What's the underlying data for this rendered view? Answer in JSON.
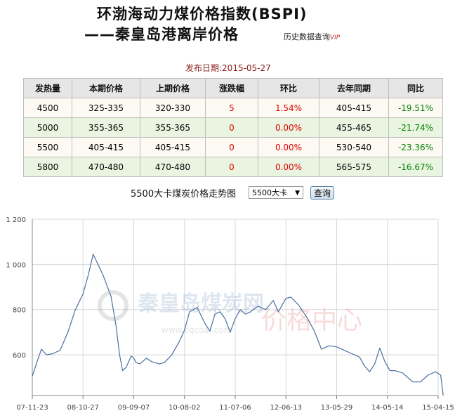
{
  "header": {
    "title": "环渤海动力煤价格指数(BSPI)",
    "subtitle": "——秦皇岛港离岸价格",
    "history_link": "历史数据查询",
    "vip": "VIP",
    "pub_date": "发布日期:2015-05-27"
  },
  "table": {
    "headers": [
      "发热量",
      "本期价格",
      "上期价格",
      "涨跌幅",
      "环比",
      "去年同期",
      "同比"
    ],
    "rows": [
      [
        "4500",
        "325-335",
        "320-330",
        "5",
        "1.54%",
        "405-415",
        "-19.51%"
      ],
      [
        "5000",
        "355-365",
        "355-365",
        "0",
        "0.00%",
        "455-465",
        "-21.74%"
      ],
      [
        "5500",
        "405-415",
        "405-415",
        "0",
        "0.00%",
        "530-540",
        "-23.36%"
      ],
      [
        "5800",
        "470-480",
        "470-480",
        "0",
        "0.00%",
        "565-575",
        "-16.67%"
      ]
    ]
  },
  "controls": {
    "chart_label": "5500大卡煤炭价格走势图",
    "select_value": "5500大卡",
    "query_button": "查询"
  },
  "watermark": {
    "site": "秦皇岛煤炭网",
    "url": "www.cqcoal.com",
    "center": "价格中心"
  },
  "colors": {
    "line": "#4a6f9e",
    "grid": "#d9d9d9",
    "up": "#e00000",
    "down": "#008000"
  },
  "chart_data": {
    "type": "line",
    "title": "",
    "xlabel": "",
    "ylabel": "",
    "grid": true,
    "ylim": [
      420,
      1200
    ],
    "yticks": [
      600,
      800,
      1000,
      1200
    ],
    "ytick_labels": [
      "600",
      "800",
      "1 000",
      "1 200"
    ],
    "xtick_labels": [
      "07-11-23",
      "08-10-27",
      "09-09-07",
      "10-08-02",
      "11-07-06",
      "12-06-13",
      "13-05-29",
      "14-05-14",
      "15-04-15"
    ],
    "series": [
      {
        "x": [
          0,
          0.08,
          0.18,
          0.28,
          0.4,
          0.55,
          0.7,
          0.85,
          1.0,
          1.1,
          1.2,
          1.4,
          1.55,
          1.65,
          1.72,
          1.78,
          1.85,
          1.9,
          1.95,
          2.0,
          2.05,
          2.12,
          2.25,
          2.35,
          2.5,
          2.6,
          2.75,
          2.9,
          3.0,
          3.1,
          3.25,
          3.4,
          3.5,
          3.6,
          3.7,
          3.8,
          3.9,
          4.0,
          4.1,
          4.2,
          4.3,
          4.45,
          4.6,
          4.75,
          4.85,
          5.0,
          5.1,
          5.25,
          5.4,
          5.55,
          5.7,
          5.85,
          6.0,
          6.15,
          6.3,
          6.45,
          6.55,
          6.65,
          6.75,
          6.85,
          6.95,
          7.0,
          7.05,
          7.15,
          7.3,
          7.5,
          7.65,
          7.8,
          7.95,
          8.05,
          8.1
        ],
        "values": [
          505,
          560,
          625,
          600,
          605,
          620,
          700,
          800,
          870,
          950,
          1045,
          950,
          860,
          730,
          600,
          530,
          545,
          570,
          595,
          585,
          565,
          560,
          585,
          570,
          560,
          565,
          600,
          660,
          710,
          790,
          810,
          740,
          705,
          780,
          790,
          760,
          700,
          760,
          800,
          780,
          790,
          815,
          800,
          840,
          790,
          850,
          855,
          820,
          770,
          710,
          625,
          640,
          635,
          620,
          605,
          590,
          550,
          525,
          560,
          630,
          570,
          550,
          530,
          530,
          520,
          480,
          480,
          510,
          525,
          510,
          420
        ]
      }
    ]
  }
}
